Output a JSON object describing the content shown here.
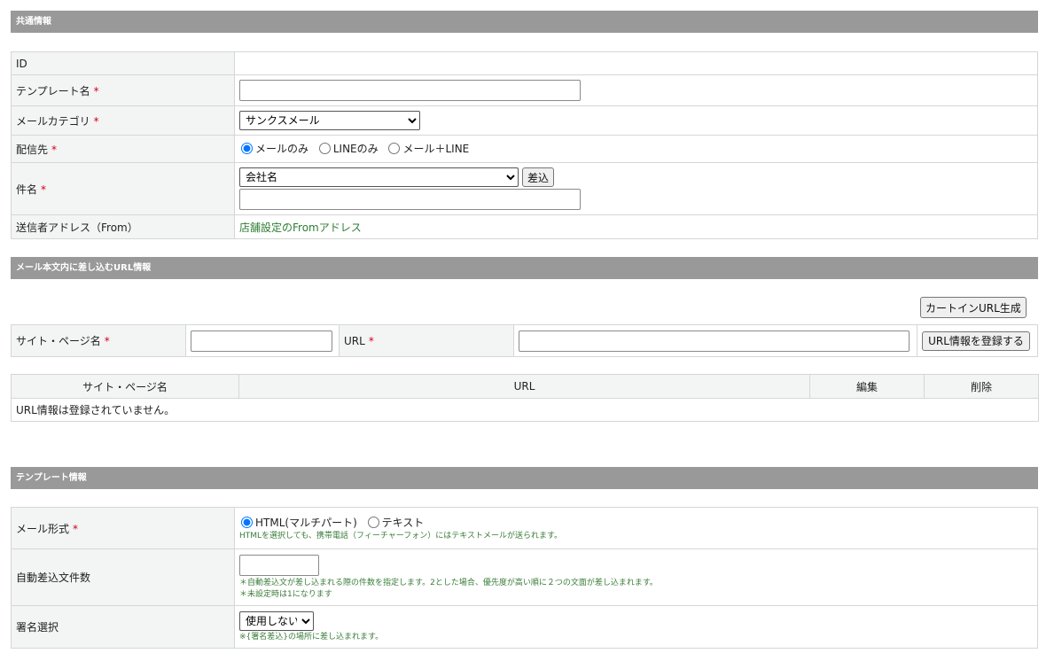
{
  "common": {
    "header": "共通情報",
    "rows": {
      "id": {
        "label": "ID",
        "value": ""
      },
      "template_name": {
        "label": "テンプレート名",
        "required": "*",
        "value": ""
      },
      "mail_category": {
        "label": "メールカテゴリ",
        "required": "*",
        "selected": "サンクスメール"
      },
      "destination": {
        "label": "配信先",
        "required": "*",
        "options": [
          "メールのみ",
          "LINEのみ",
          "メール＋LINE"
        ],
        "selected_index": 0
      },
      "subject": {
        "label": "件名",
        "required": "*",
        "insert_selected": "会社名",
        "insert_button": "差込",
        "value": ""
      },
      "from": {
        "label": "送信者アドレス（From）",
        "value": "店舗設定のFromアドレス"
      }
    }
  },
  "url_info": {
    "header": "メール本文内に差し込むURL情報",
    "cartin_button": "カートインURL生成",
    "site_label": "サイト・ページ名",
    "site_required": "*",
    "url_label": "URL",
    "url_required": "*",
    "register_button": "URL情報を登録する",
    "table": {
      "columns": [
        "サイト・ページ名",
        "URL",
        "編集",
        "削除"
      ],
      "empty_message": "URL情報は登録されていません。"
    }
  },
  "template": {
    "header": "テンプレート情報",
    "rows": {
      "mail_format": {
        "label": "メール形式",
        "required": "*",
        "options": [
          "HTML(マルチパート)",
          "テキスト"
        ],
        "selected_index": 0,
        "note": "HTMLを選択しても、携帯電話（フィーチャーフォン）にはテキストメールが送られます。"
      },
      "auto_insert_count": {
        "label": "自動差込文件数",
        "value": "",
        "note1": "＊自動差込文が差し込まれる際の件数を指定します。2とした場合、優先度が高い順に２つの文面が差し込まれます。",
        "note2": "＊未設定時は1になります"
      },
      "signature": {
        "label": "署名選択",
        "selected": "使用しない",
        "note": "※{署名差込}の場所に差し込まれます。"
      }
    }
  }
}
